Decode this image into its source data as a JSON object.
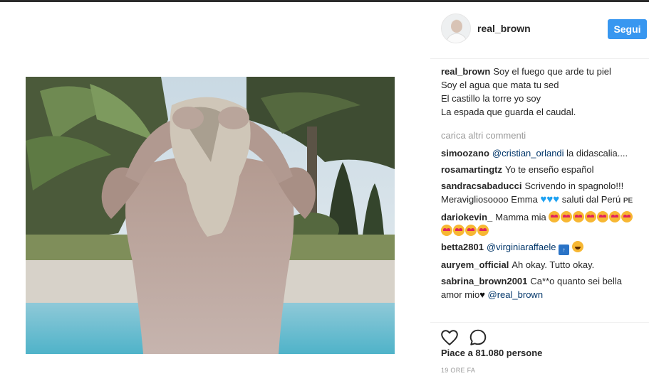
{
  "post": {
    "author": "real_brown",
    "follow_label": "Segui",
    "caption_lines": [
      "Soy el fuego que arde tu piel",
      "Soy el agua que mata tu sed",
      "El castillo la torre yo soy",
      "La espada que guarda el caudal."
    ],
    "load_more_label": "carica altri commenti",
    "comments": [
      {
        "user": "simoozano",
        "mention": "@cristian_orlandi",
        "text": " la didascalia...."
      },
      {
        "user": "rosamartingtz",
        "text": "Yo te enseño español"
      },
      {
        "user": "sandracsabaducci",
        "text": "Scrivendo in spagnolo!!! Meravigliosoooo Emma",
        "text_after": " saluti dal Perú",
        "flag": "PE"
      },
      {
        "user": "dariokevin_",
        "text": "Mamma mia"
      },
      {
        "user": "betta2801",
        "mention": "@virginiaraffaele"
      },
      {
        "user": "auryem_official",
        "text": "Ah okay. Tutto okay."
      },
      {
        "user": "sabrina_brown2001",
        "text": "Ca**o quanto sei bella amor mio",
        "mention": "@real_brown"
      }
    ],
    "likes_label": "Piace a 81.080 persone",
    "timestamp": "19 ORE FA"
  },
  "icons": {
    "like": "heart-outline-icon",
    "comment": "speech-bubble-icon",
    "emoji_heart_eyes": "heart-eyes-emoji",
    "emoji_blue_heart": "blue-heart-emoji",
    "emoji_black_heart": "black-heart-emoji"
  },
  "colors": {
    "follow_button": "#3897f0",
    "mention": "#003569",
    "muted": "#999999",
    "text": "#262626"
  }
}
